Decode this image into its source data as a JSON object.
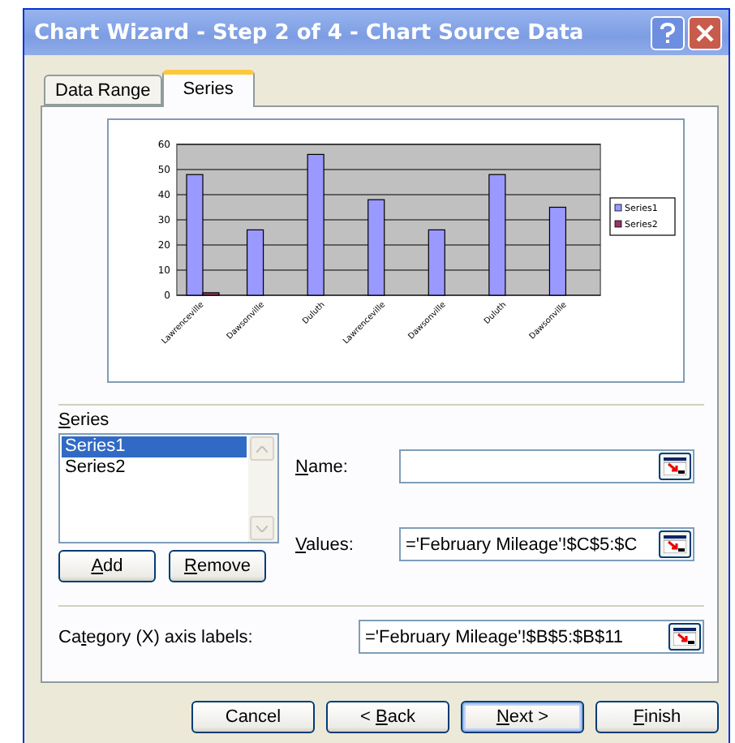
{
  "window": {
    "title": "Chart Wizard - Step 2 of 4 - Chart Source Data"
  },
  "tabs": [
    {
      "label": "Data Range",
      "selected": false
    },
    {
      "label": "Series",
      "selected": true
    }
  ],
  "chart_data": {
    "type": "bar",
    "categories": [
      "Lawrenceville",
      "Dawsonville",
      "Duluth",
      "Lawrenceville",
      "Dawsonville",
      "Duluth",
      "Dawsonville"
    ],
    "series": [
      {
        "name": "Series1",
        "color": "#9999ff",
        "values": [
          48,
          26,
          56,
          38,
          26,
          48,
          35
        ]
      },
      {
        "name": "Series2",
        "color": "#993366",
        "values": [
          1,
          null,
          null,
          null,
          null,
          null,
          null
        ]
      }
    ],
    "ylim": [
      0,
      60
    ],
    "yticks": [
      0,
      10,
      20,
      30,
      40,
      50,
      60
    ],
    "grid": true,
    "legend": "right"
  },
  "series_section": {
    "label": "Series",
    "items": [
      {
        "label": "Series1",
        "selected": true
      },
      {
        "label": "Series2",
        "selected": false
      }
    ],
    "buttons": [
      {
        "label": "Add"
      },
      {
        "label": "Remove"
      }
    ]
  },
  "fields": [
    {
      "label": "Name:"
    },
    {
      "label": "Values:",
      "value": "='February Mileage'!$C$5:$C"
    }
  ],
  "category_field": {
    "label": "Category (X) axis labels:",
    "value": "='February Mileage'!$B$5:$B$11"
  },
  "buttons": [
    {
      "label": "Cancel",
      "default": false
    },
    {
      "label": "< Back",
      "default": false
    },
    {
      "label": "Next >",
      "default": true
    },
    {
      "label": "Finish",
      "default": false
    }
  ]
}
